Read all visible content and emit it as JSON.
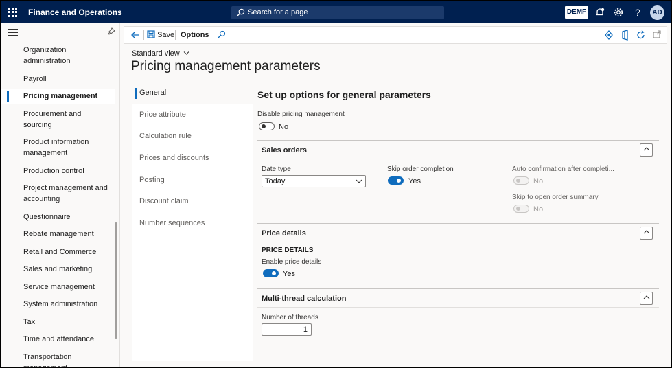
{
  "app": {
    "title": "Finance and Operations",
    "search_placeholder": "Search for a page",
    "company": "DEMF",
    "avatar_initials": "AD",
    "help_glyph": "?"
  },
  "nav": {
    "items": [
      {
        "label": "Organization administration"
      },
      {
        "label": "Payroll"
      },
      {
        "label": "Pricing management",
        "selected": true
      },
      {
        "label": "Procurement and sourcing"
      },
      {
        "label": "Product information management"
      },
      {
        "label": "Production control"
      },
      {
        "label": "Project management and accounting"
      },
      {
        "label": "Questionnaire"
      },
      {
        "label": "Rebate management"
      },
      {
        "label": "Retail and Commerce"
      },
      {
        "label": "Sales and marketing"
      },
      {
        "label": "Service management"
      },
      {
        "label": "System administration"
      },
      {
        "label": "Tax"
      },
      {
        "label": "Time and attendance"
      },
      {
        "label": "Transportation management"
      }
    ]
  },
  "actionbar": {
    "save_label": "Save",
    "options_label": "Options"
  },
  "header": {
    "view_label": "Standard view",
    "page_title": "Pricing management parameters"
  },
  "tabs": [
    {
      "label": "General",
      "selected": true
    },
    {
      "label": "Price attribute"
    },
    {
      "label": "Calculation rule"
    },
    {
      "label": "Prices and discounts"
    },
    {
      "label": "Posting"
    },
    {
      "label": "Discount claim"
    },
    {
      "label": "Number sequences"
    }
  ],
  "general": {
    "title": "Set up options for general parameters",
    "disable_label": "Disable pricing management",
    "disable_value": "No",
    "sales_orders": {
      "title": "Sales orders",
      "date_type_label": "Date type",
      "date_type_value": "Today",
      "skip_order_label": "Skip order completion",
      "skip_order_value": "Yes",
      "auto_confirm_label": "Auto confirmation after completi...",
      "auto_confirm_value": "No",
      "skip_summary_label": "Skip to open order summary",
      "skip_summary_value": "No"
    },
    "price_details": {
      "title": "Price details",
      "subheading": "PRICE DETAILS",
      "enable_label": "Enable price details",
      "enable_value": "Yes"
    },
    "multithread": {
      "title": "Multi-thread calculation",
      "threads_label": "Number of threads",
      "threads_value": "1"
    }
  }
}
